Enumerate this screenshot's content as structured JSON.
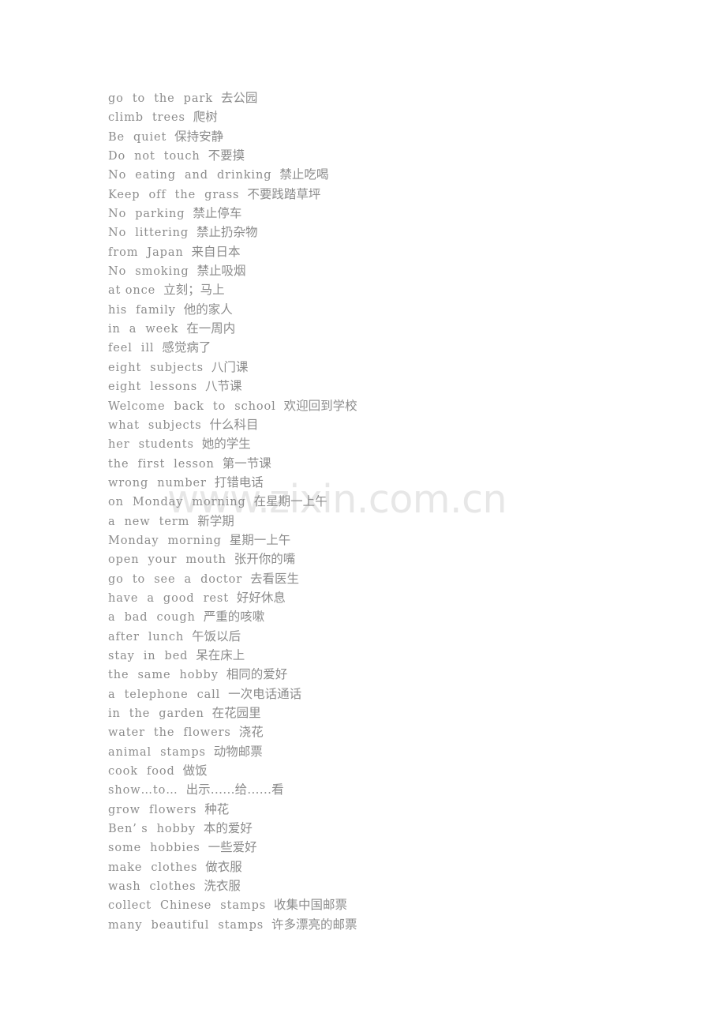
{
  "document": {
    "page_background": "#ffffff",
    "text_color": "#8c8c8c",
    "watermark_color": "#e7e7e7"
  },
  "watermark": {
    "text": "www.zixin.com.cn"
  },
  "phrases": [
    {
      "en": "go  to  the  park",
      "zh": "去公园"
    },
    {
      "en": "climb  trees",
      "zh": "爬树"
    },
    {
      "en": "Be  quiet",
      "zh": "保持安静"
    },
    {
      "en": "Do  not  touch",
      "zh": "不要摸"
    },
    {
      "en": "No  eating  and  drinking",
      "zh": "禁止吃喝"
    },
    {
      "en": "Keep  off  the  grass",
      "zh": "不要践踏草坪"
    },
    {
      "en": "No  parking",
      "zh": "禁止停车"
    },
    {
      "en": "No  littering",
      "zh": "禁止扔杂物"
    },
    {
      "en": "from  Japan",
      "zh": "来自日本"
    },
    {
      "en": "No  smoking",
      "zh": "禁止吸烟"
    },
    {
      "en": "at once",
      "zh": "立刻；马上"
    },
    {
      "en": "his  family",
      "zh": "他的家人"
    },
    {
      "en": "in  a  week",
      "zh": "在一周内"
    },
    {
      "en": "feel  ill",
      "zh": "感觉病了"
    },
    {
      "en": "eight  subjects",
      "zh": "八门课"
    },
    {
      "en": "eight  lessons",
      "zh": "八节课"
    },
    {
      "en": "Welcome  back  to  school",
      "zh": "欢迎回到学校"
    },
    {
      "en": "what  subjects",
      "zh": "什么科目"
    },
    {
      "en": "her  students",
      "zh": "她的学生"
    },
    {
      "en": "the  first  lesson",
      "zh": "第一节课"
    },
    {
      "en": "wrong  number",
      "zh": "打错电话"
    },
    {
      "en": "on  Monday  morning",
      "zh": "在星期一上午"
    },
    {
      "en": "a  new  term",
      "zh": "新学期"
    },
    {
      "en": "Monday  morning",
      "zh": "星期一上午"
    },
    {
      "en": "open  your  mouth",
      "zh": "张开你的嘴"
    },
    {
      "en": "go  to  see  a  doctor",
      "zh": "去看医生"
    },
    {
      "en": "have  a  good  rest",
      "zh": "好好休息"
    },
    {
      "en": "a  bad  cough",
      "zh": "严重的咳嗽"
    },
    {
      "en": "after  lunch",
      "zh": "午饭以后"
    },
    {
      "en": "stay  in  bed",
      "zh": "呆在床上"
    },
    {
      "en": "the  same  hobby",
      "zh": "相同的爱好"
    },
    {
      "en": "a  telephone  call",
      "zh": "一次电话通话"
    },
    {
      "en": "in  the  garden",
      "zh": "在花园里"
    },
    {
      "en": "water  the  flowers",
      "zh": "浇花"
    },
    {
      "en": "animal  stamps",
      "zh": "动物邮票"
    },
    {
      "en": "cook  food",
      "zh": "做饭"
    },
    {
      "en": "show…to…",
      "zh": "出示……给……看"
    },
    {
      "en": "grow  flowers",
      "zh": "种花"
    },
    {
      "en": "Ben’ s  hobby",
      "zh": "本的爱好"
    },
    {
      "en": "some  hobbies",
      "zh": "一些爱好"
    },
    {
      "en": "make  clothes",
      "zh": "做衣服"
    },
    {
      "en": "wash  clothes",
      "zh": "洗衣服"
    },
    {
      "en": "collect  Chinese  stamps",
      "zh": "收集中国邮票"
    },
    {
      "en": "many  beautiful  stamps",
      "zh": "许多漂亮的邮票"
    }
  ]
}
